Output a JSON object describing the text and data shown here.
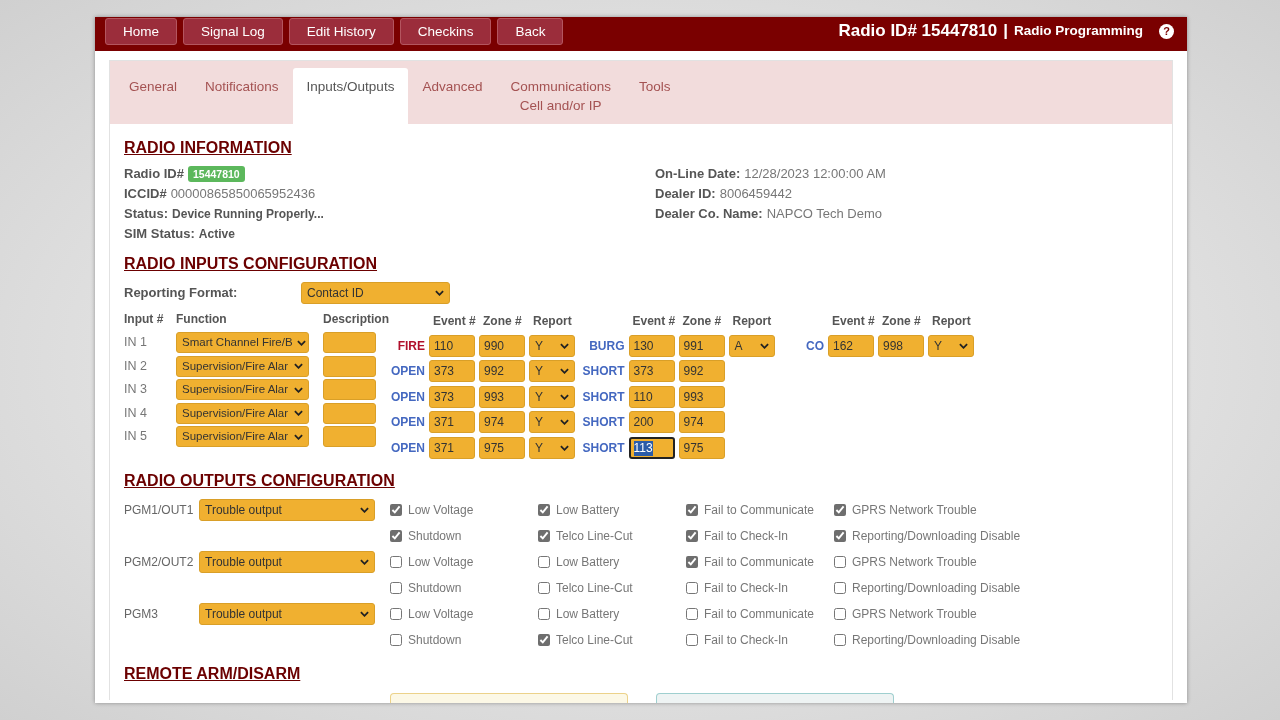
{
  "header": {
    "nav": [
      {
        "label": "Home"
      },
      {
        "label": "Signal Log"
      },
      {
        "label": "Edit History"
      },
      {
        "label": "Checkins"
      },
      {
        "label": "Back"
      }
    ],
    "title": "Radio ID# 15447810",
    "divider": "|",
    "subtitle": "Radio Programming",
    "help": "?"
  },
  "tabs": [
    {
      "label": "General",
      "selected": false
    },
    {
      "label": "Notifications",
      "selected": false
    },
    {
      "label": "Inputs/Outputs",
      "selected": true
    },
    {
      "label": "Advanced",
      "selected": false
    },
    {
      "label": "Communications",
      "sublabel": "Cell and/or IP",
      "selected": false
    },
    {
      "label": "Tools",
      "selected": false
    }
  ],
  "radio_information": {
    "heading": "RADIO INFORMATION",
    "left": [
      {
        "label": "Radio ID#",
        "value": "15447810",
        "kind": "badge"
      },
      {
        "label": "ICCID#",
        "value": "00000865850065952436",
        "kind": "text"
      },
      {
        "label": "Status:",
        "value": "Device Running Properly...",
        "kind": "strong"
      },
      {
        "label": "SIM Status:",
        "value": "Active",
        "kind": "strong"
      }
    ],
    "right": [
      {
        "label": "On-Line Date:",
        "value": "12/28/2023 12:00:00 AM",
        "kind": "text"
      },
      {
        "label": "Dealer ID:",
        "value": "8006459442",
        "kind": "text"
      },
      {
        "label": "Dealer Co. Name:",
        "value": "NAPCO Tech Demo",
        "kind": "text"
      }
    ]
  },
  "inputs_configuration": {
    "heading": "RADIO INPUTS CONFIGURATION",
    "reporting_format": {
      "label": "Reporting Format:",
      "value": "Contact ID"
    },
    "columns": [
      "Input #",
      "Function",
      "Description"
    ],
    "inputs": [
      {
        "name": "IN 1",
        "function": "Smart Channel Fire/B"
      },
      {
        "name": "IN 2",
        "function": "Supervision/Fire Alar"
      },
      {
        "name": "IN 3",
        "function": "Supervision/Fire Alar"
      },
      {
        "name": "IN 4",
        "function": "Supervision/Fire Alar"
      },
      {
        "name": "IN 5",
        "function": "Supervision/Fire Alar"
      }
    ],
    "event_groups": [
      {
        "columns": [
          "Event #",
          "Zone #",
          "Report"
        ],
        "rows": [
          {
            "label": "FIRE",
            "color": "#b0102c",
            "event": "110",
            "zone": "990",
            "report": "Y",
            "focused": false
          },
          {
            "label": "OPEN",
            "color": "#4468c0",
            "event": "373",
            "zone": "992",
            "report": "Y",
            "focused": false
          },
          {
            "label": "OPEN",
            "color": "#4468c0",
            "event": "373",
            "zone": "993",
            "report": "Y",
            "focused": false
          },
          {
            "label": "OPEN",
            "color": "#4468c0",
            "event": "371",
            "zone": "974",
            "report": "Y",
            "focused": false
          },
          {
            "label": "OPEN",
            "color": "#4468c0",
            "event": "371",
            "zone": "975",
            "report": "Y",
            "focused": false
          }
        ]
      },
      {
        "columns": [
          "Event #",
          "Zone #",
          "Report"
        ],
        "rows": [
          {
            "label": "BURG",
            "color": "#4468c0",
            "event": "130",
            "zone": "991",
            "report": "A",
            "focused": false
          },
          {
            "label": "SHORT",
            "color": "#4468c0",
            "event": "373",
            "zone": "992",
            "focused": false
          },
          {
            "label": "SHORT",
            "color": "#4468c0",
            "event": "110",
            "zone": "993",
            "focused": false
          },
          {
            "label": "SHORT",
            "color": "#4468c0",
            "event": "200",
            "zone": "974",
            "focused": false
          },
          {
            "label": "SHORT",
            "color": "#4468c0",
            "event": "113",
            "zone": "975",
            "focused": true
          }
        ]
      },
      {
        "columns": [
          "Event #",
          "Zone #",
          "Report"
        ],
        "rows": [
          {
            "label": "CO",
            "color": "#4468c0",
            "event": "162",
            "zone": "998",
            "report": "Y",
            "focused": false
          }
        ]
      }
    ]
  },
  "outputs_configuration": {
    "heading": "RADIO OUTPUTS CONFIGURATION",
    "outputs": [
      {
        "name": "PGM1/OUT1",
        "mode": "Trouble output",
        "options": [
          {
            "label": "Low Voltage",
            "checked": true
          },
          {
            "label": "Low Battery",
            "checked": true
          },
          {
            "label": "Fail to Communicate",
            "checked": true
          },
          {
            "label": "GPRS Network Trouble",
            "checked": true
          },
          {
            "label": "Shutdown",
            "checked": true
          },
          {
            "label": "Telco Line-Cut",
            "checked": true
          },
          {
            "label": "Fail to Check-In",
            "checked": true
          },
          {
            "label": "Reporting/Downloading Disable",
            "checked": true
          }
        ]
      },
      {
        "name": "PGM2/OUT2",
        "mode": "Trouble output",
        "options": [
          {
            "label": "Low Voltage",
            "checked": false
          },
          {
            "label": "Low Battery",
            "checked": false
          },
          {
            "label": "Fail to Communicate",
            "checked": true
          },
          {
            "label": "GPRS Network Trouble",
            "checked": false
          },
          {
            "label": "Shutdown",
            "checked": false
          },
          {
            "label": "Telco Line-Cut",
            "checked": false
          },
          {
            "label": "Fail to Check-In",
            "checked": false
          },
          {
            "label": "Reporting/Downloading Disable",
            "checked": false
          }
        ]
      },
      {
        "name": "PGM3",
        "mode": "Trouble output",
        "options": [
          {
            "label": "Low Voltage",
            "checked": false
          },
          {
            "label": "Low Battery",
            "checked": false
          },
          {
            "label": "Fail to Communicate",
            "checked": false
          },
          {
            "label": "GPRS Network Trouble",
            "checked": false
          },
          {
            "label": "Shutdown",
            "checked": false
          },
          {
            "label": "Telco Line-Cut",
            "checked": true
          },
          {
            "label": "Fail to Check-In",
            "checked": false
          },
          {
            "label": "Reporting/Downloading Disable",
            "checked": false
          }
        ]
      }
    ]
  },
  "remote_arm": {
    "heading": "REMOTE ARM/DISARM",
    "panels": [
      {
        "kind": "warning"
      },
      {
        "kind": "info"
      }
    ]
  }
}
